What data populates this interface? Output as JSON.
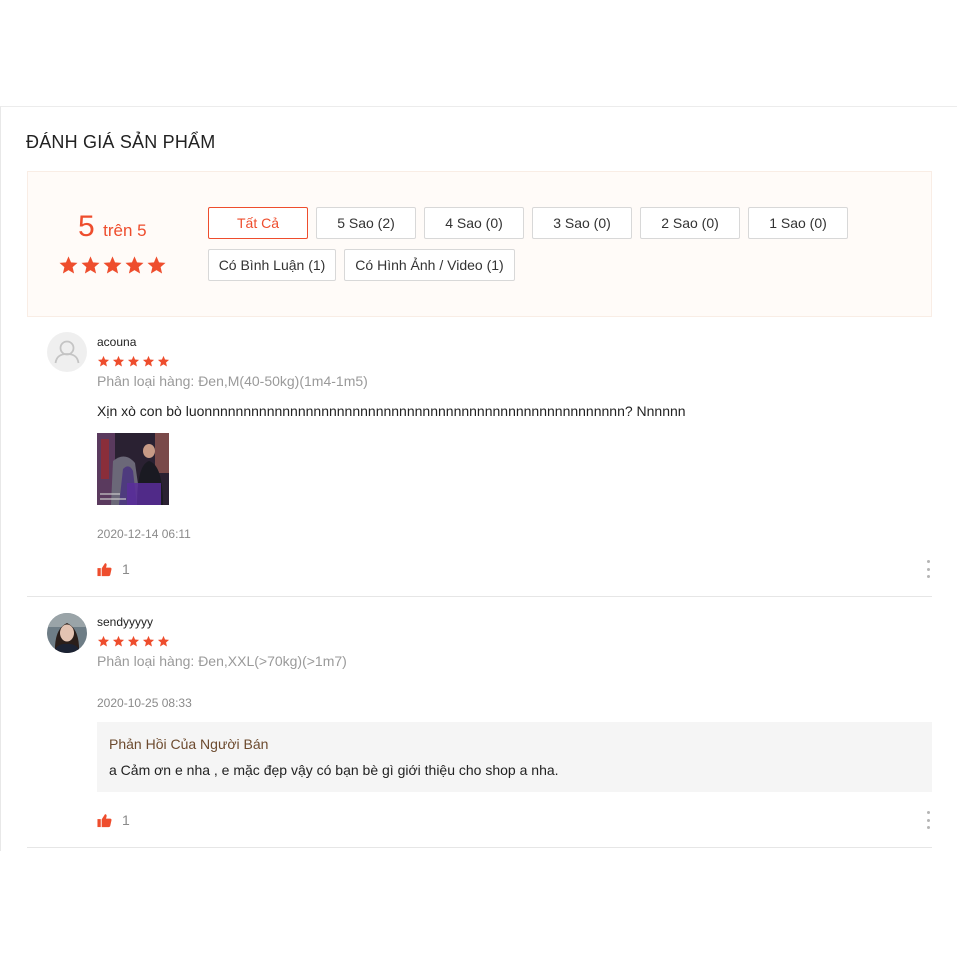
{
  "section": {
    "title": "ĐÁNH GIÁ SẢN PHẨM"
  },
  "overview": {
    "score": "5",
    "score_suffix": "trên 5",
    "rating": 5,
    "filters": [
      {
        "label": "Tất Cả",
        "active": true
      },
      {
        "label": "5 Sao (2)",
        "active": false
      },
      {
        "label": "4 Sao (0)",
        "active": false
      },
      {
        "label": "3 Sao (0)",
        "active": false
      },
      {
        "label": "2 Sao (0)",
        "active": false
      },
      {
        "label": "1 Sao (0)",
        "active": false
      },
      {
        "label": "Có Bình Luận (1)",
        "active": false
      },
      {
        "label": "Có Hình Ảnh / Video (1)",
        "active": false
      }
    ]
  },
  "reviews": [
    {
      "username": "acouna",
      "rating": 5,
      "variant": "Phân loại hàng: Đen,M(40-50kg)(1m4-1m5)",
      "comment": "Xịn xò con bò luonnnnnnnnnnnnnnnnnnnnnnnnnnnnnnnnnnnnnnnnnnnnnnnnnnnnnn? Nnnnnn",
      "date": "2020-12-14 06:11",
      "likes": "1"
    },
    {
      "username": "sendyyyyy",
      "rating": 5,
      "variant": "Phân loại hàng: Đen,XXL(>70kg)(>1m7)",
      "date": "2020-10-25 08:33",
      "reply_title": "Phản Hồi Của Người Bán",
      "reply_text": "a Cảm ơn e nha , e mặc đẹp vậy có bạn bè gì giới thiệu cho shop a nha.",
      "likes": "1"
    }
  ],
  "colors": {
    "accent": "#ee4d2d",
    "overview_bg": "#fffbf8",
    "reply_bg": "#f5f5f5"
  },
  "icons": {
    "star": "star-icon",
    "like": "thumbs-up-icon",
    "more": "more-vertical-icon",
    "avatar": "user-icon"
  }
}
